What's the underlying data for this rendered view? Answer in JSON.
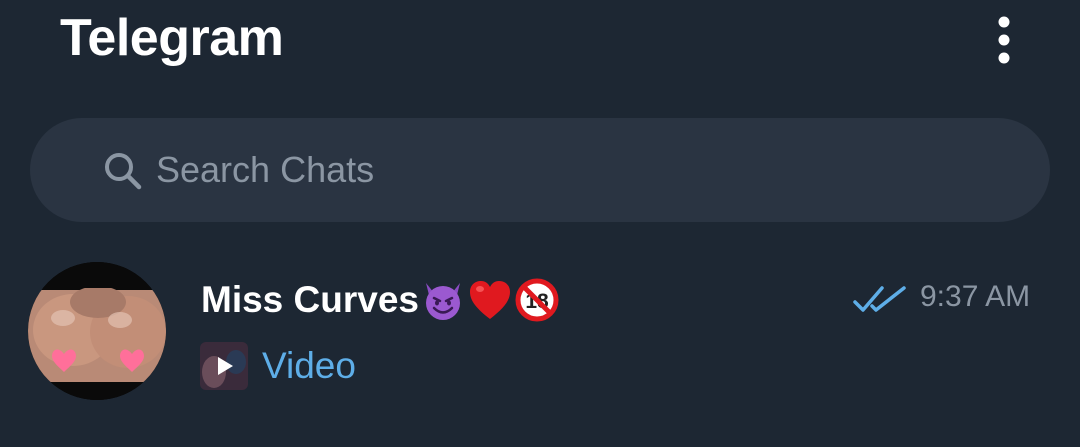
{
  "header": {
    "title": "Telegram",
    "menu_icon": "more-vertical-icon"
  },
  "search": {
    "placeholder": "Search Chats",
    "icon": "search-icon"
  },
  "chats": [
    {
      "name": "Miss Curves",
      "name_emojis": [
        "smiling-face-with-horns",
        "red-heart",
        "no-one-under-18"
      ],
      "time": "9:37 AM",
      "read_status": "double-check-read",
      "preview": "Video",
      "preview_type": "video-thumbnail"
    }
  ],
  "colors": {
    "background": "#1d2733",
    "search_background": "#2a3442",
    "accent_blue": "#5eaee8",
    "muted_text": "#8b96a3",
    "title_text": "#ffffff"
  }
}
